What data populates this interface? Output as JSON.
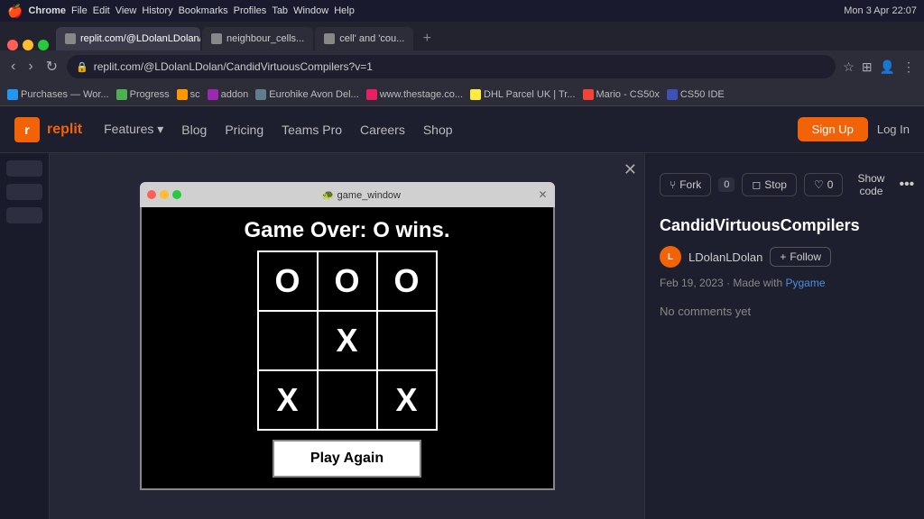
{
  "osBar": {
    "apple": "🍎",
    "appName": "Chrome",
    "menus": [
      "Chrome",
      "File",
      "Edit",
      "View",
      "History",
      "Bookmarks",
      "Profiles",
      "Tab",
      "Window",
      "Help"
    ],
    "time": "Mon 3 Apr  22:07"
  },
  "tabs": [
    {
      "label": "replit.com/@LDolanLDolan/Can..."
    },
    {
      "label": "neighbour_cells..."
    },
    {
      "label": "cell' and 'cou..."
    }
  ],
  "addressBar": {
    "url": "replit.com/@LDolanLDolan/CandidVirtuousCompilers?v=1"
  },
  "bookmarks": [
    "Purchases — Wor...",
    "Progress",
    "sc",
    "addon",
    "Eurohike Avon Del...",
    "www.thestage.co...",
    "DHL Parcel UK | Tr...",
    "Mario - CS50x",
    "CS50 IDE"
  ],
  "replitNav": {
    "logo": "replit",
    "links": [
      "Features",
      "Blog",
      "Pricing",
      "Teams Pro",
      "Careers",
      "Shop"
    ],
    "signup": "Sign Up",
    "login": "Log In"
  },
  "windowTitle": "🐢 game_window",
  "gameOverText": "Game Over: O wins.",
  "board": [
    [
      "O",
      "O",
      "O"
    ],
    [
      "",
      "X",
      ""
    ],
    [
      "X",
      "",
      "X"
    ]
  ],
  "playAgainLabel": "Play Again",
  "toolbar": {
    "forkLabel": "Fork",
    "forkCount": "0",
    "stopLabel": "Stop",
    "likeCount": "0",
    "showCodeLabel": "Show code",
    "moreLabel": "•••"
  },
  "project": {
    "title": "CandidVirtuousCompilers",
    "authorInitials": "L",
    "authorName": "LDolanLDolan",
    "followLabel": "Follow",
    "date": "Feb 19, 2023",
    "madeWith": "Made with",
    "framework": "Pygame",
    "noComments": "No comments yet"
  }
}
